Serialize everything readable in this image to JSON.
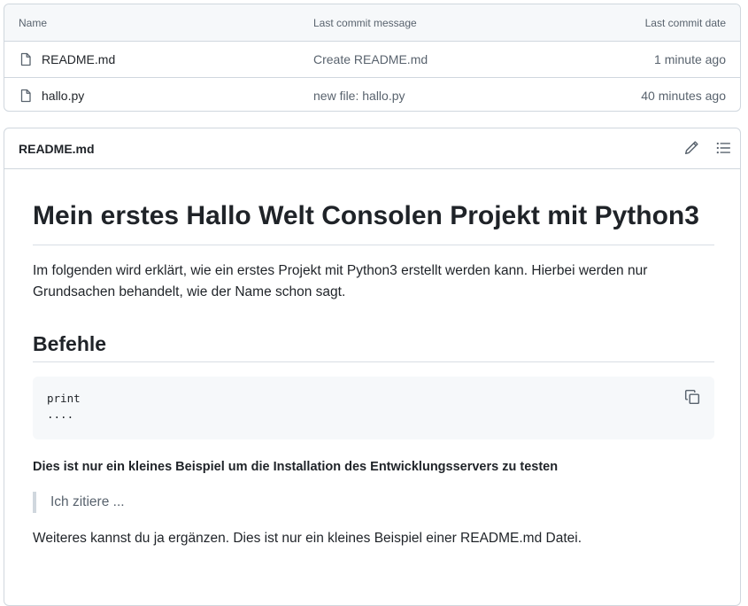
{
  "files_table": {
    "headers": {
      "name": "Name",
      "message": "Last commit message",
      "date": "Last commit date"
    },
    "rows": [
      {
        "name": "README.md",
        "message": "Create README.md",
        "date": "1 minute ago",
        "icon": "file-icon"
      },
      {
        "name": "hallo.py",
        "message": "new file: hallo.py",
        "date": "40 minutes ago",
        "icon": "file-icon"
      }
    ]
  },
  "readme": {
    "title": "README.md",
    "actions": {
      "edit_icon": "pencil-icon",
      "outline_icon": "list-unordered-icon"
    },
    "content": {
      "h1": "Mein erstes Hallo Welt Consolen Projekt mit Python3",
      "intro": "Im folgenden wird erklärt, wie ein erstes Projekt mit Python3 erstellt werden kann. Hierbei werden nur Grundsachen behandelt, wie der Name schon sagt.",
      "h2": "Befehle",
      "code_lines": [
        "print",
        "...."
      ],
      "bold_text": "Dies ist nur ein kleines Beispiel um die Installation des Entwicklungsservers zu testen",
      "blockquote": "Ich zitiere ...",
      "closing": "Weiteres kannst du ja ergänzen. Dies ist nur ein kleines Beispiel einer README.md Datei."
    }
  },
  "colors": {
    "border": "#d0d7de",
    "header_bg": "#f6f8fa",
    "muted_text": "#59636e",
    "text": "#1f2328"
  }
}
